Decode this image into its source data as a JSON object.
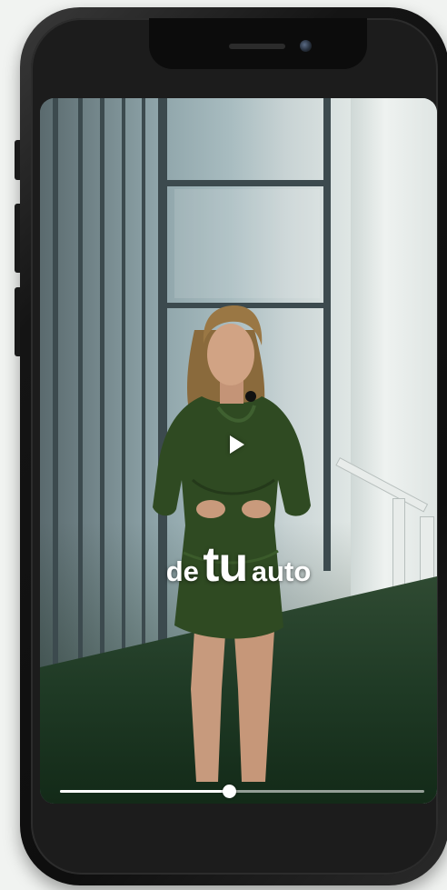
{
  "video": {
    "caption_pre": "de",
    "caption_main": "tu",
    "caption_post": "auto",
    "progress_fraction": 0.465
  },
  "icons": {
    "play": "play-icon",
    "camera": "camera-icon",
    "speaker": "speaker-grille"
  },
  "colors": {
    "caption": "#ffffff",
    "dress": "#2f4a22",
    "phone_frame": "#111111",
    "progress_track": "#ffffff"
  }
}
